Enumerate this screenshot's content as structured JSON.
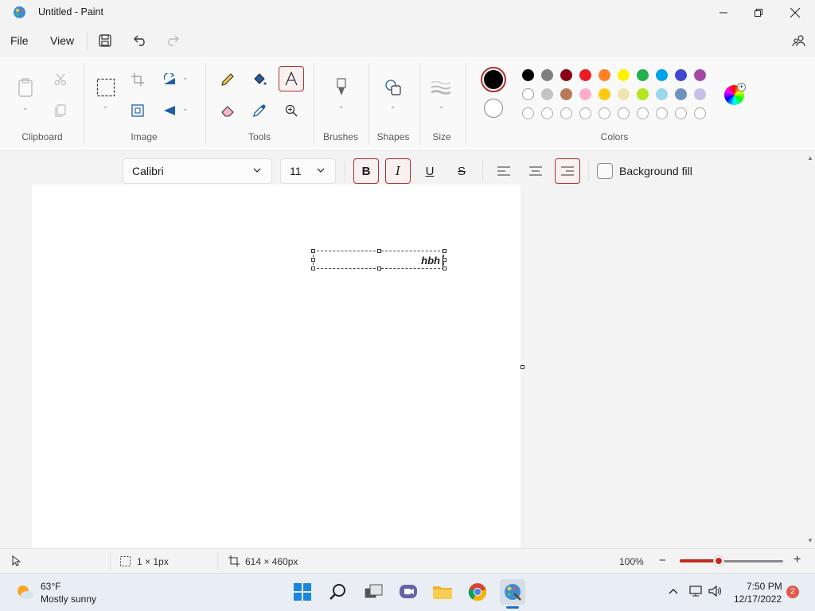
{
  "window": {
    "title": "Untitled - Paint"
  },
  "menu": {
    "file": "File",
    "view": "View"
  },
  "ribbon": {
    "groups": {
      "clipboard": "Clipboard",
      "image": "Image",
      "tools": "Tools",
      "brushes": "Brushes",
      "shapes": "Shapes",
      "size": "Size",
      "colors": "Colors"
    },
    "primary_color": "#000000",
    "secondary_color": "#ffffff",
    "palette_row1": [
      "#000000",
      "#7f7f7f",
      "#880015",
      "#ed1c24",
      "#ff7f27",
      "#fff200",
      "#22b14c",
      "#00a2e8",
      "#3f48cc",
      "#a349a4"
    ],
    "palette_row2": [
      "#ffffff",
      "#c3c3c3",
      "#b97a57",
      "#ffaec9",
      "#ffc90e",
      "#efe4b0",
      "#b5e61d",
      "#99d9ea",
      "#7092be",
      "#c8bfe7"
    ],
    "palette_row3_empty": 10
  },
  "text_toolbar": {
    "font": "Calibri",
    "size": "11",
    "bold_label": "B",
    "italic_label": "I",
    "underline_label": "U",
    "strike_label": "S",
    "background_fill": "Background fill",
    "active": {
      "bold": true,
      "italic": true,
      "underline": false,
      "strikethrough": false,
      "align": "right"
    }
  },
  "canvas": {
    "text": "hbh"
  },
  "status": {
    "selection": "1 × 1px",
    "canvas_size": "614 × 460px",
    "zoom": "100%",
    "zoom_minus": "−",
    "zoom_plus": "+"
  },
  "taskbar": {
    "weather_temp": "63°F",
    "weather_desc": "Mostly sunny",
    "time": "7:50 PM",
    "date": "12/17/2022",
    "notifications": "2"
  }
}
